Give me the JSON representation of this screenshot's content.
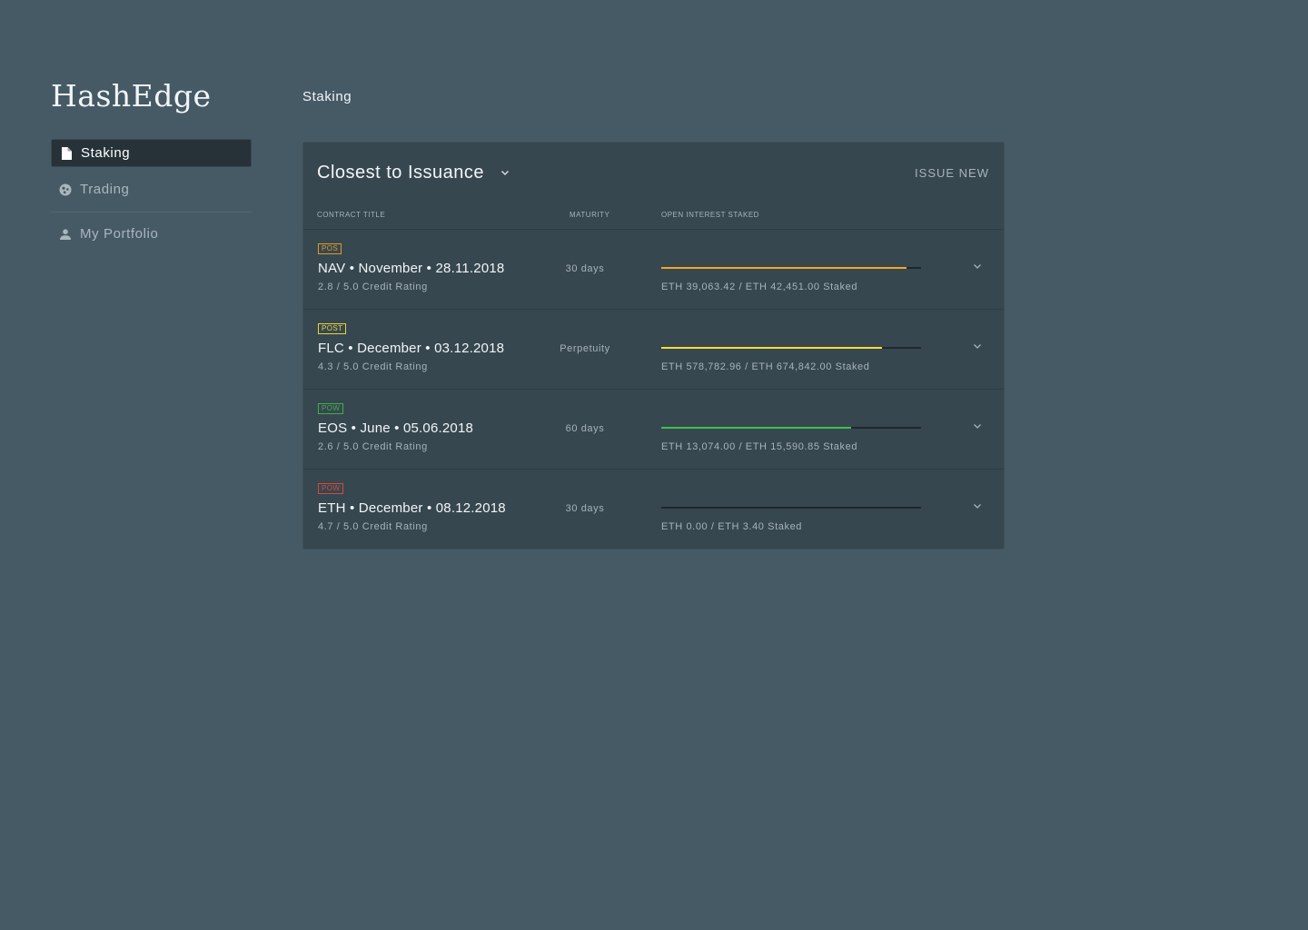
{
  "app": {
    "name": "HashEdge"
  },
  "sidebar": {
    "items": [
      {
        "label": "Staking",
        "icon": "document-icon",
        "active": true
      },
      {
        "label": "Trading",
        "icon": "globe-icon",
        "active": false
      },
      {
        "label": "My Portfolio",
        "icon": "user-icon",
        "active": false
      }
    ]
  },
  "page": {
    "title": "Staking"
  },
  "card": {
    "sort_label": "Closest to Issuance",
    "issue_new_label": "ISSUE NEW",
    "columns": {
      "contract_title": "CONTRACT TITLE",
      "maturity": "MATURITY",
      "open_interest": "OPEN INTEREST STAKED"
    },
    "rows": [
      {
        "badge": "POS",
        "badge_color": "#e09a2c",
        "title": "NAV • November • 28.11.2018",
        "rating": "2.8 / 5.0 Credit Rating",
        "maturity": "30 days",
        "progress": 0.944,
        "bar_color": "#f5a623",
        "staked": "ETH 39,063.42 / ETH 42,451.00 Staked"
      },
      {
        "badge": "POST",
        "badge_color": "#e6d43c",
        "title": "FLC • December • 03.12.2018",
        "rating": "4.3 / 5.0 Credit Rating",
        "maturity": "Perpetuity",
        "progress": 0.85,
        "bar_color": "#f4de3a",
        "staked": "ETH 578,782.96 / ETH 674,842.00 Staked"
      },
      {
        "badge": "POW",
        "badge_color": "#3fae4c",
        "title": "EOS • June • 05.06.2018",
        "rating": "2.6 / 5.0 Credit Rating",
        "maturity": "60 days",
        "progress": 0.73,
        "bar_color": "#3fbf4f",
        "staked": "ETH 13,074.00 / ETH 15,590.85 Staked"
      },
      {
        "badge": "POW",
        "badge_color": "#d14a3c",
        "title": "ETH • December • 08.12.2018",
        "rating": "4.7 / 5.0 Credit Rating",
        "maturity": "30 days",
        "progress": 0,
        "bar_color": "#d14a3c",
        "staked": "ETH 0.00 / ETH 3.40 Staked"
      }
    ]
  }
}
